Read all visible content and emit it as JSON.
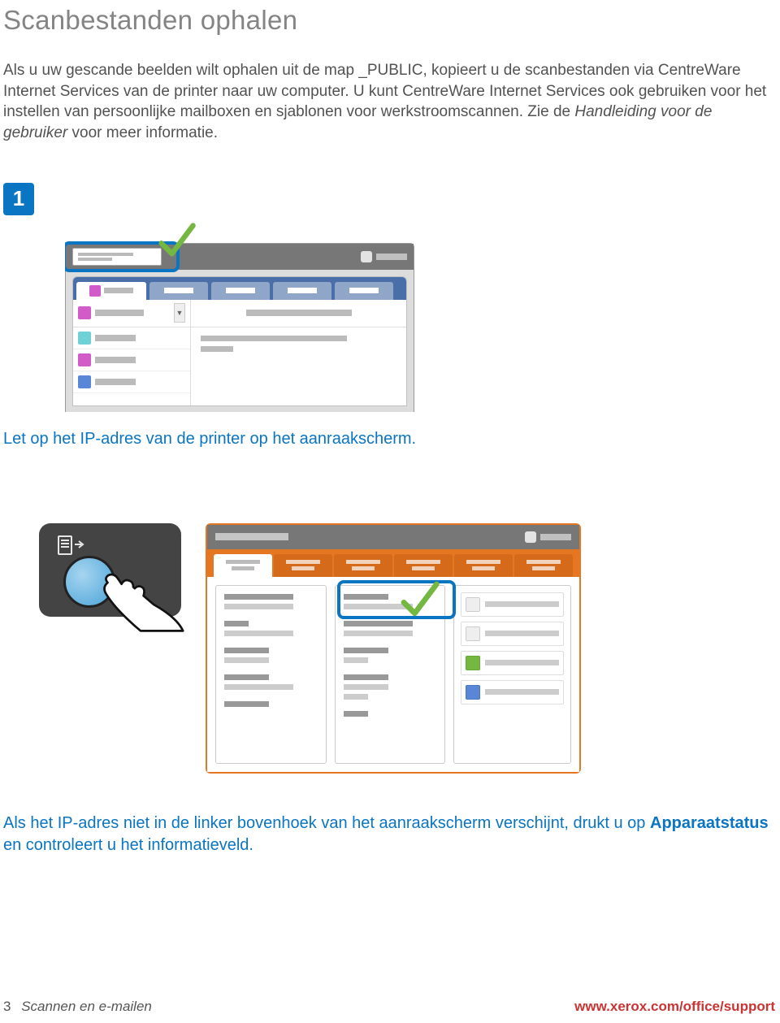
{
  "title": "Scanbestanden ophalen",
  "intro": {
    "p1": "Als u uw gescande beelden wilt ophalen uit de map _PUBLIC, kopieert u de scanbestanden via CentreWare Internet Services van de printer naar uw computer. U kunt CentreWare Internet Services ook gebruiken voor het instellen van persoonlijke mailboxen en sjablonen voor werkstroomscannen. Zie de ",
    "italic": "Handleiding voor de gebruiker",
    "p2": " voor meer informatie."
  },
  "step1": {
    "number": "1",
    "caption": "Let op het IP-adres van de printer op het aanraakscherm."
  },
  "step2": {
    "caption_pre": "Als het IP-adres niet in de linker bovenhoek van het aanraakscherm verschijnt, drukt u op ",
    "caption_bold": "Apparaatstatus",
    "caption_post": " en controleert u het informatieveld."
  },
  "footer": {
    "page_number": "3",
    "doc_title": "Scannen en e-mailen",
    "url": "www.xerox.com/office/support"
  }
}
